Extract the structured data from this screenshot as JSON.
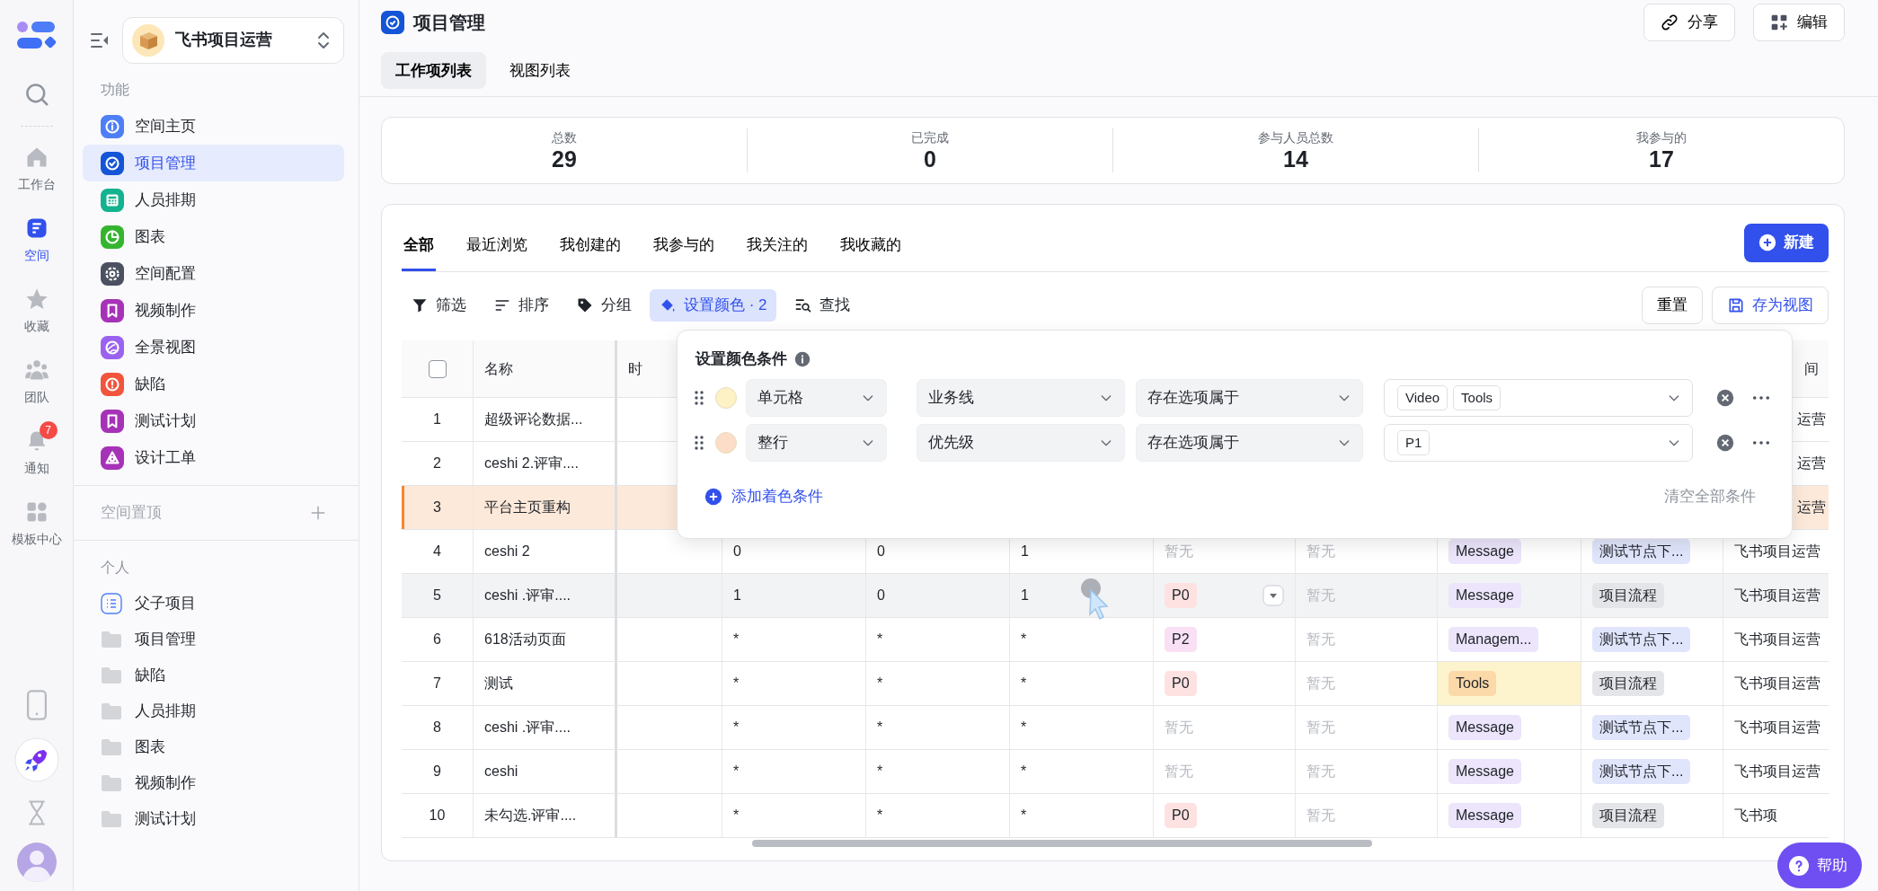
{
  "rail": {
    "items": [
      {
        "label": "工作台",
        "selected": false
      },
      {
        "label": "空间",
        "selected": true
      },
      {
        "label": "收藏",
        "selected": false
      },
      {
        "label": "团队",
        "selected": false
      },
      {
        "label": "通知",
        "selected": false,
        "badge": "7"
      },
      {
        "label": "模板中心",
        "selected": false
      }
    ]
  },
  "sidebar": {
    "workspace": "飞书项目运营",
    "features_title": "功能",
    "features": [
      {
        "label": "空间主页",
        "selected": false,
        "color": "#4e7ff7"
      },
      {
        "label": "项目管理",
        "selected": true,
        "color": "#1454d6"
      },
      {
        "label": "人员排期",
        "selected": false,
        "color": "#14b38f"
      },
      {
        "label": "图表",
        "selected": false,
        "color": "#35b52f"
      },
      {
        "label": "空间配置",
        "selected": false,
        "color": "#4b5160"
      },
      {
        "label": "视频制作",
        "selected": false,
        "color": "#a632b8"
      },
      {
        "label": "全景视图",
        "selected": false,
        "color": "#9b62f0"
      },
      {
        "label": "缺陷",
        "selected": false,
        "color": "#f2543c"
      },
      {
        "label": "测试计划",
        "selected": false,
        "color": "#a632b8"
      },
      {
        "label": "设计工单",
        "selected": false,
        "color": "#a632b8"
      }
    ],
    "pinned_title": "空间置顶",
    "personal_title": "个人",
    "personal": [
      {
        "label": "父子项目",
        "kind": "list"
      },
      {
        "label": "项目管理",
        "kind": "folder"
      },
      {
        "label": "缺陷",
        "kind": "folder"
      },
      {
        "label": "人员排期",
        "kind": "folder"
      },
      {
        "label": "图表",
        "kind": "folder"
      },
      {
        "label": "视频制作",
        "kind": "folder"
      },
      {
        "label": "测试计划",
        "kind": "folder"
      }
    ]
  },
  "page": {
    "title": "项目管理",
    "actions": [
      "分享",
      "编辑"
    ],
    "tabs": [
      {
        "label": "工作项列表",
        "selected": true
      },
      {
        "label": "视图列表",
        "selected": false
      }
    ]
  },
  "stats": [
    {
      "label": "总数",
      "value": "29"
    },
    {
      "label": "已完成",
      "value": "0"
    },
    {
      "label": "参与人员总数",
      "value": "14"
    },
    {
      "label": "我参与的",
      "value": "17"
    }
  ],
  "views": {
    "tabs": [
      {
        "label": "全部",
        "selected": true
      },
      {
        "label": "最近浏览",
        "selected": false
      },
      {
        "label": "我创建的",
        "selected": false
      },
      {
        "label": "我参与的",
        "selected": false
      },
      {
        "label": "我关注的",
        "selected": false
      },
      {
        "label": "我收藏的",
        "selected": false
      }
    ],
    "new_button": "新建",
    "tools": [
      {
        "label": "筛选",
        "active": false
      },
      {
        "label": "排序",
        "active": false
      },
      {
        "label": "分组",
        "active": false
      },
      {
        "label": "设置颜色 · 2",
        "active": true
      },
      {
        "label": "查找",
        "active": false
      }
    ],
    "reset": "重置",
    "save_view": "存为视图"
  },
  "color_popup": {
    "title": "设置颜色条件",
    "conditions": [
      {
        "color": "#fdf1c6",
        "scope": "单元格",
        "field": "业务线",
        "operator": "存在选项属于",
        "values": [
          "Video",
          "Tools"
        ]
      },
      {
        "color": "#fbddc8",
        "scope": "整行",
        "field": "优先级",
        "operator": "存在选项属于",
        "values": [
          "P1"
        ]
      }
    ],
    "add": "添加着色条件",
    "clear": "清空全部条件"
  },
  "table": {
    "header": {
      "checked": false,
      "name": "名称",
      "column_3": "时",
      "column_11": "间"
    },
    "rows": [
      {
        "no": "1",
        "name": "超级评论数据...",
        "highlighted": false,
        "hovered": false,
        "column_11": "运营"
      },
      {
        "no": "2",
        "name": "ceshi 2.评审....",
        "highlighted": false,
        "hovered": false,
        "column_11": "运营"
      },
      {
        "no": "3",
        "name": "平台主页重构",
        "highlighted": true,
        "hovered": false,
        "column_11": "运营"
      },
      {
        "no": "4",
        "name": "ceshi 2",
        "highlighted": false,
        "hovered": false,
        "column_11": "飞书项目运营",
        "cells": [
          {
            "kind": "plain",
            "text": "0"
          },
          {
            "kind": "plain",
            "text": "0"
          },
          {
            "kind": "plain",
            "text": "1"
          },
          {
            "kind": "none",
            "text": "暂无"
          },
          {
            "kind": "none",
            "text": "暂无"
          },
          {
            "kind": "tag",
            "text": "Message",
            "color": "#ece5fb",
            "highlighted": false
          },
          {
            "kind": "tag",
            "text": "测试节点下...",
            "color": "#e1e5fb"
          }
        ]
      },
      {
        "no": "5",
        "name": "ceshi .评审....",
        "highlighted": false,
        "hovered": true,
        "column_11": "飞书项目运营",
        "cells": [
          {
            "kind": "plain",
            "text": "1"
          },
          {
            "kind": "plain",
            "text": "0"
          },
          {
            "kind": "plain",
            "text": "1"
          },
          {
            "kind": "tag",
            "text": "P0",
            "color": "#fde2e1"
          },
          {
            "kind": "none",
            "text": "暂无"
          },
          {
            "kind": "tag",
            "text": "Message",
            "color": "#ece5fb",
            "highlighted": false
          },
          {
            "kind": "tag",
            "text": "项目流程",
            "color": "#e4e5e9"
          }
        ]
      },
      {
        "no": "6",
        "name": "618活动页面",
        "highlighted": false,
        "hovered": false,
        "column_11": "飞书项目运营",
        "cells": [
          {
            "kind": "plain",
            "text": "*"
          },
          {
            "kind": "plain",
            "text": "*"
          },
          {
            "kind": "plain",
            "text": "*"
          },
          {
            "kind": "tag",
            "text": "P2",
            "color": "#f9e0f4"
          },
          {
            "kind": "none",
            "text": "暂无"
          },
          {
            "kind": "tag",
            "text": "Managem...",
            "color": "#ece5fb",
            "highlighted": false
          },
          {
            "kind": "tag",
            "text": "测试节点下...",
            "color": "#e1e5fb"
          }
        ]
      },
      {
        "no": "7",
        "name": "测试",
        "highlighted": false,
        "hovered": false,
        "column_11": "飞书项目运营",
        "cells": [
          {
            "kind": "plain",
            "text": "*"
          },
          {
            "kind": "plain",
            "text": "*"
          },
          {
            "kind": "plain",
            "text": "*"
          },
          {
            "kind": "tag",
            "text": "P0",
            "color": "#fde2e1"
          },
          {
            "kind": "none",
            "text": "暂无"
          },
          {
            "kind": "tag",
            "text": "Tools",
            "color": "#fcd9a8",
            "highlighted": true
          },
          {
            "kind": "tag",
            "text": "项目流程",
            "color": "#e4e5e9"
          }
        ]
      },
      {
        "no": "8",
        "name": "ceshi .评审....",
        "highlighted": false,
        "hovered": false,
        "column_11": "飞书项目运营",
        "cells": [
          {
            "kind": "plain",
            "text": "*"
          },
          {
            "kind": "plain",
            "text": "*"
          },
          {
            "kind": "plain",
            "text": "*"
          },
          {
            "kind": "none",
            "text": "暂无"
          },
          {
            "kind": "none",
            "text": "暂无"
          },
          {
            "kind": "tag",
            "text": "Message",
            "color": "#ece5fb",
            "highlighted": false
          },
          {
            "kind": "tag",
            "text": "测试节点下...",
            "color": "#e1e5fb"
          }
        ]
      },
      {
        "no": "9",
        "name": "ceshi",
        "highlighted": false,
        "hovered": false,
        "column_11": "飞书项目运营",
        "cells": [
          {
            "kind": "plain",
            "text": "*"
          },
          {
            "kind": "plain",
            "text": "*"
          },
          {
            "kind": "plain",
            "text": "*"
          },
          {
            "kind": "none",
            "text": "暂无"
          },
          {
            "kind": "none",
            "text": "暂无"
          },
          {
            "kind": "tag",
            "text": "Message",
            "color": "#ece5fb",
            "highlighted": false
          },
          {
            "kind": "tag",
            "text": "测试节点下...",
            "color": "#e1e5fb"
          }
        ]
      },
      {
        "no": "10",
        "name": "未勾选.评审....",
        "highlighted": false,
        "hovered": false,
        "column_11": "飞书项",
        "cells": [
          {
            "kind": "plain",
            "text": "*"
          },
          {
            "kind": "plain",
            "text": "*"
          },
          {
            "kind": "plain",
            "text": "*"
          },
          {
            "kind": "tag",
            "text": "P0",
            "color": "#fde2e1"
          },
          {
            "kind": "none",
            "text": "暂无"
          },
          {
            "kind": "tag",
            "text": "Message",
            "color": "#ece5fb",
            "highlighted": false
          },
          {
            "kind": "tag",
            "text": "项目流程",
            "color": "#e4e5e9"
          }
        ]
      }
    ]
  },
  "help": "帮助"
}
